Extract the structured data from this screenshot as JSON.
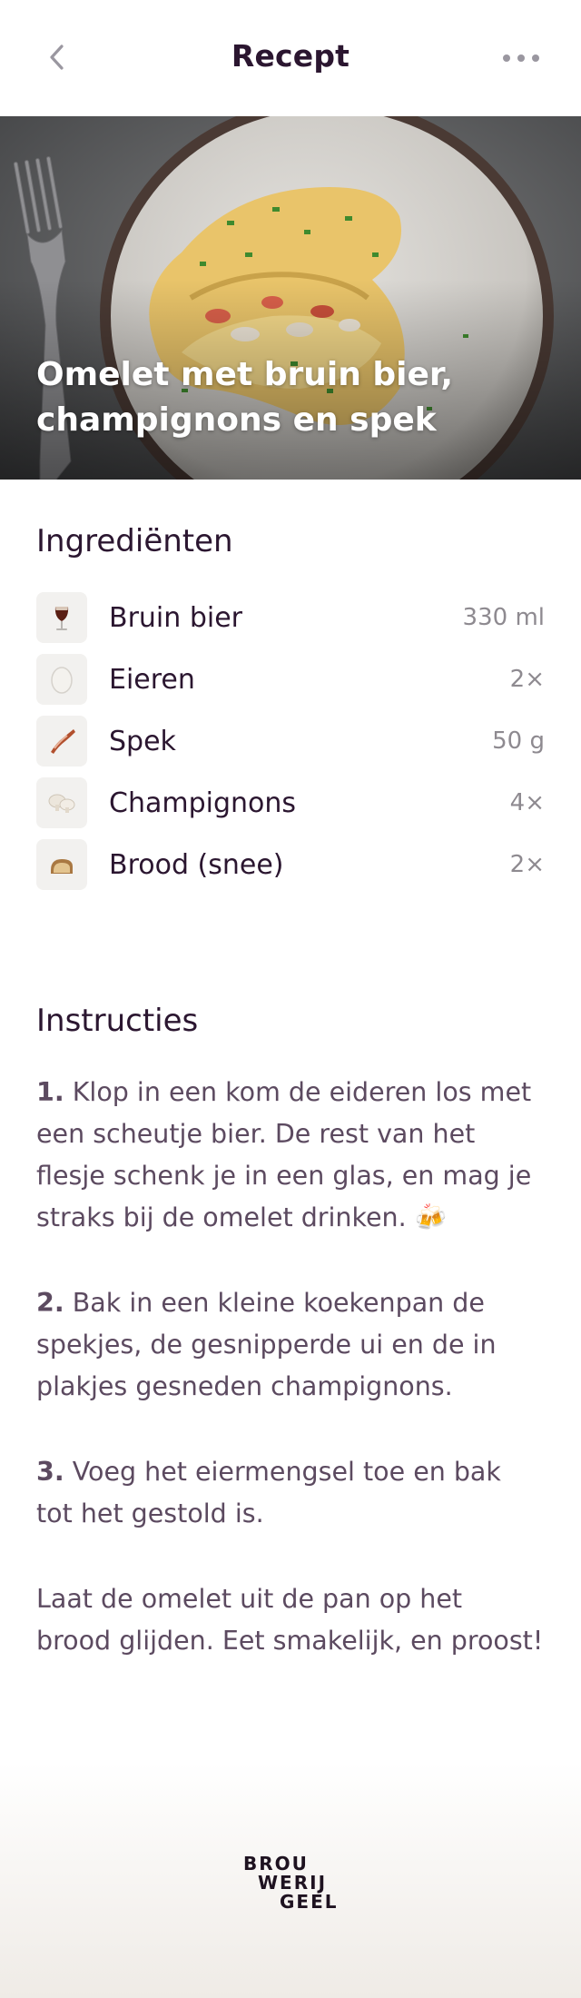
{
  "header": {
    "title": "Recept",
    "back_icon": "chevron-left-icon",
    "more_icon": "more-dots-icon"
  },
  "hero": {
    "title": "Omelet met bruin bier, champignons en spek"
  },
  "ingredients": {
    "title": "Ingrediënten",
    "items": [
      {
        "name": "Bruin bier",
        "qty": "330 ml",
        "icon": "beer-glass-icon"
      },
      {
        "name": "Eieren",
        "qty": "2×",
        "icon": "egg-icon"
      },
      {
        "name": "Spek",
        "qty": "50 g",
        "icon": "bacon-icon"
      },
      {
        "name": "Champignons",
        "qty": "4×",
        "icon": "mushroom-icon"
      },
      {
        "name": "Brood (snee)",
        "qty": "2×",
        "icon": "bread-icon"
      }
    ]
  },
  "instructions": {
    "title": "Instructies",
    "steps": [
      {
        "num": "1.",
        "text": "Klop in een kom de eideren los met een scheutje bier. De rest van het flesje schenk je in een glas, en mag je straks bij de omelet drinken. 🍻"
      },
      {
        "num": "2.",
        "text": "Bak in een kleine koekenpan de spekjes, de gesnipperde ui en de in plakjes gesneden champignons."
      },
      {
        "num": "3.",
        "text": "Voeg het eiermengsel toe en bak tot het gestold is."
      }
    ],
    "closing": "Laat de omelet uit de pan op het brood glijden. Eet smakelijk, en proost!"
  },
  "footer": {
    "logo_lines": [
      "BROU",
      "WERIJ",
      "GEEL"
    ]
  },
  "colors": {
    "text_dark": "#2b1630",
    "text_body": "#5c4a60",
    "text_muted": "#8e8a90",
    "icon_grey": "#9a97a0"
  }
}
